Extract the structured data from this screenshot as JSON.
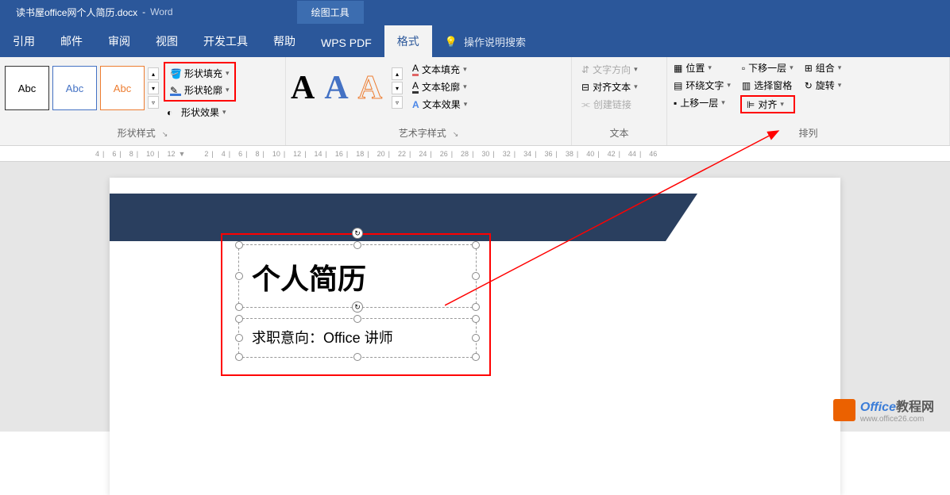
{
  "titlebar": {
    "filename": "读书屋office网个人简历.docx",
    "separator": "-",
    "appname": "Word",
    "context_tool": "绘图工具"
  },
  "tabs": {
    "items": [
      "引用",
      "邮件",
      "审阅",
      "视图",
      "开发工具",
      "帮助",
      "WPS PDF",
      "格式"
    ],
    "active_index": 7,
    "search_label": "操作说明搜索"
  },
  "ribbon": {
    "shape_styles": {
      "title": "形状样式",
      "presets": [
        "Abc",
        "Abc",
        "Abc"
      ],
      "fill_label": "形状填充",
      "outline_label": "形状轮廓",
      "effects_label": "形状效果"
    },
    "wordart": {
      "title": "艺术字样式",
      "text_fill": "文本填充",
      "text_outline": "文本轮廓",
      "text_effects": "文本效果"
    },
    "text": {
      "title": "文本",
      "direction": "文字方向",
      "align_text": "对齐文本",
      "create_link": "创建链接"
    },
    "arrange": {
      "title": "排列",
      "position": "位置",
      "wrap_text": "环绕文字",
      "bring_forward": "上移一层",
      "send_backward": "下移一层",
      "selection_pane": "选择窗格",
      "align": "对齐",
      "group": "组合",
      "rotate": "旋转"
    }
  },
  "ruler": {
    "ticks": [
      "4",
      "6",
      "8",
      "10",
      "12",
      "",
      "2",
      "4",
      "6",
      "8",
      "10",
      "12",
      "14",
      "16",
      "18",
      "20",
      "22",
      "24",
      "26",
      "28",
      "30",
      "32",
      "34",
      "36",
      "38",
      "40",
      "42",
      "44",
      "46"
    ]
  },
  "document": {
    "heading": "个人简历",
    "subheading": "求职意向：Office 讲师"
  },
  "watermark": {
    "text1": "Office",
    "text2": "教程网",
    "url": "www.office26.com"
  }
}
